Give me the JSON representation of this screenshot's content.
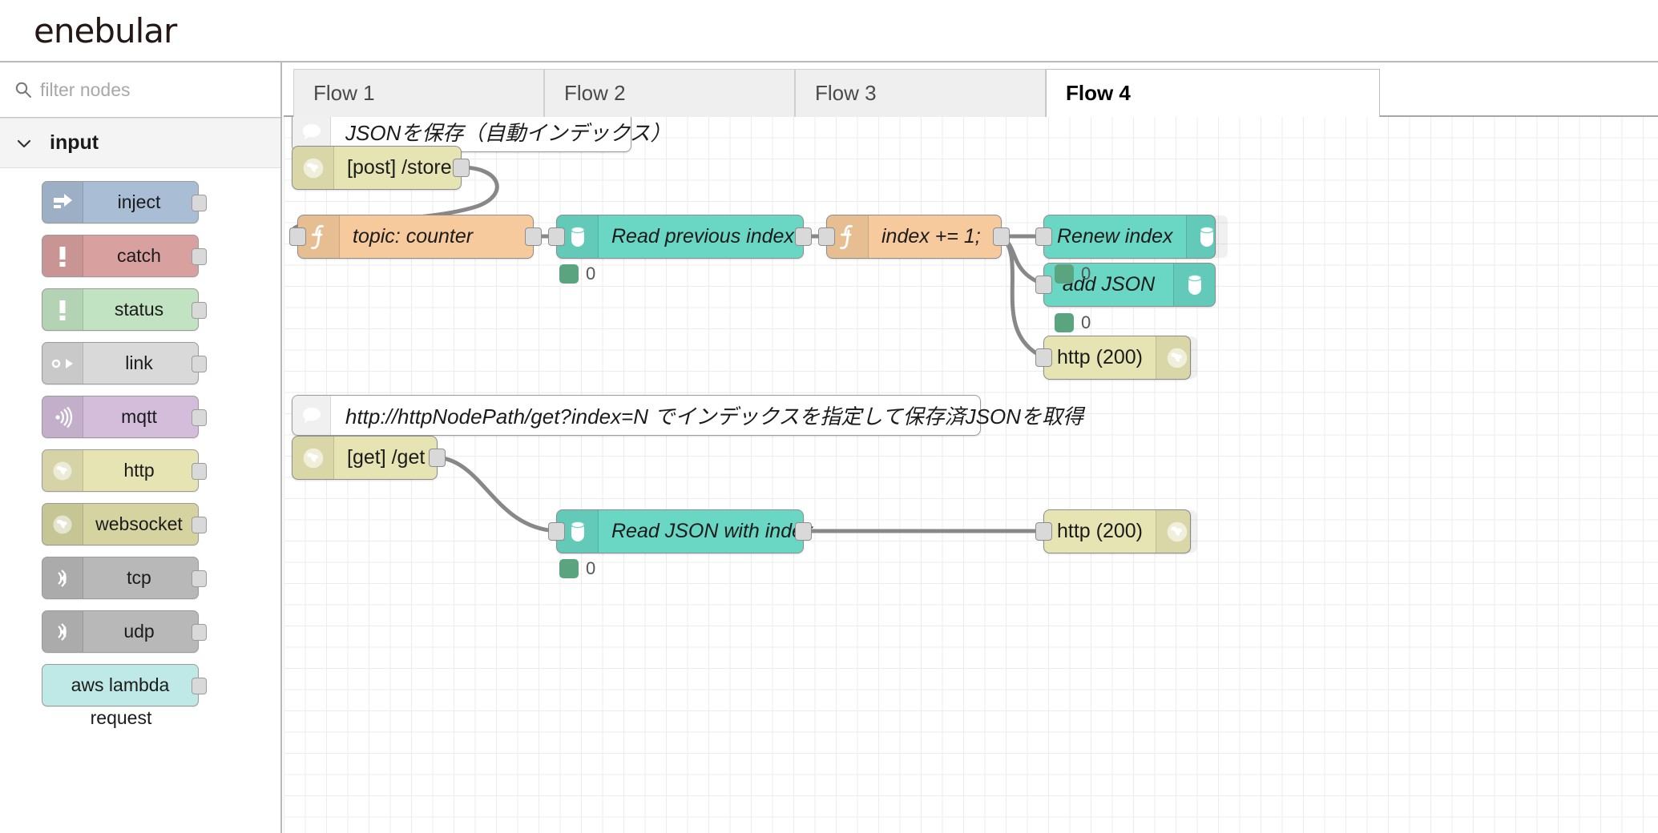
{
  "brand": {
    "name": "enebular"
  },
  "search": {
    "placeholder": "filter nodes",
    "value": "",
    "icon": "search-icon"
  },
  "palette": {
    "category": {
      "label": "input",
      "icon": "chevron-down-icon",
      "expanded": true
    },
    "items": [
      {
        "label": "inject",
        "icon": "inject-arrow-icon",
        "color": "#a9bdd4",
        "has_port": true,
        "class": "c-inject"
      },
      {
        "label": "catch",
        "icon": "exclamation-icon",
        "color": "#d9a0a0",
        "has_port": true,
        "class": "c-catch"
      },
      {
        "label": "status",
        "icon": "exclamation-icon",
        "color": "#c2e3c2",
        "has_port": true,
        "class": "c-status"
      },
      {
        "label": "link",
        "icon": "link-arrow-icon",
        "color": "#d9d9d9",
        "has_port": true,
        "class": "c-link"
      },
      {
        "label": "mqtt",
        "icon": "broadcast-icon",
        "color": "#d3bddb",
        "has_port": true,
        "class": "c-mqtt"
      },
      {
        "label": "http",
        "icon": "globe-icon",
        "color": "#d5d4a0",
        "has_port": true,
        "class": "c-http"
      },
      {
        "label": "websocket",
        "icon": "globe-icon",
        "color": "#d5d4a0",
        "has_port": true,
        "class": "c-websocket"
      },
      {
        "label": "tcp",
        "icon": "signal-icon",
        "color": "#b8b8b8",
        "has_port": true,
        "class": "c-tcp"
      },
      {
        "label": "udp",
        "icon": "signal-icon",
        "color": "#b8b8b8",
        "has_port": true,
        "class": "c-udp"
      },
      {
        "label": "aws lambda",
        "sublabel": "request",
        "icon": "none",
        "color": "#bfe9e7",
        "has_port": true,
        "class": "c-lambda"
      }
    ]
  },
  "tabs": [
    {
      "label": "Flow 1",
      "active": false
    },
    {
      "label": "Flow 2",
      "active": false
    },
    {
      "label": "Flow 3",
      "active": false
    },
    {
      "label": "Flow 4",
      "active": true
    }
  ],
  "canvas": {
    "comments": [
      {
        "id": "comment-store",
        "text": "JSONを保存（自動インデックス）",
        "icon": "comment-icon"
      },
      {
        "id": "comment-get",
        "text": "http://httpNodePath/get?index=N でインデックスを指定して保存済JSONを取得",
        "icon": "comment-icon"
      }
    ],
    "nodes": [
      {
        "id": "http-in-store",
        "label": "[post] /store",
        "icon": "globe-icon",
        "color": "#e7e4b3",
        "type": "http-in"
      },
      {
        "id": "func-topic",
        "label": "topic: counter",
        "icon": "function-icon",
        "color": "#f6ca9c",
        "type": "function"
      },
      {
        "id": "db-read-prev",
        "label": "Read previous index",
        "icon": "database-icon",
        "color": "#6ad6c4",
        "type": "database",
        "status": "0"
      },
      {
        "id": "func-index-inc",
        "label": "index += 1;",
        "icon": "function-icon",
        "color": "#f6ca9c",
        "type": "function"
      },
      {
        "id": "db-renew-index",
        "label": "Renew index",
        "icon": "database-icon",
        "color": "#6ad6c4",
        "type": "database",
        "status": "0"
      },
      {
        "id": "db-add-json",
        "label": "add JSON",
        "icon": "database-icon",
        "color": "#6ad6c4",
        "type": "database",
        "status": "0"
      },
      {
        "id": "http-resp-store",
        "label": "http (200)",
        "icon": "globe-icon",
        "color": "#e7e4b3",
        "type": "http-response"
      },
      {
        "id": "http-in-get",
        "label": "[get] /get",
        "icon": "globe-icon",
        "color": "#e7e4b3",
        "type": "http-in"
      },
      {
        "id": "db-read-json",
        "label": "Read JSON with index",
        "icon": "database-icon",
        "color": "#6ad6c4",
        "type": "database",
        "status": "0"
      },
      {
        "id": "http-resp-get",
        "label": "http (200)",
        "icon": "globe-icon",
        "color": "#e7e4b3",
        "type": "http-response"
      }
    ]
  },
  "colors": {
    "brand_text": "#231815",
    "wire": "#888888",
    "status_dot": "#5aa580",
    "grid": "#ececec"
  }
}
